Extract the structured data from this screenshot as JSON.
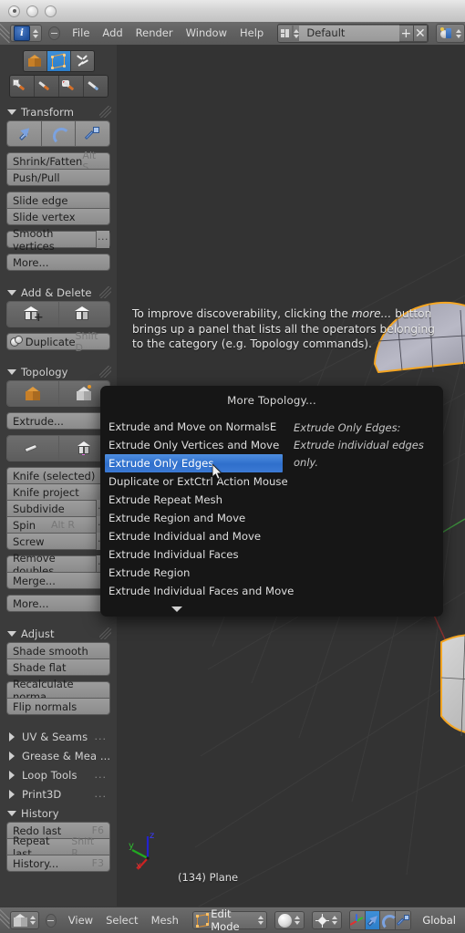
{
  "window": {
    "title_buttons": [
      "close",
      "minimize",
      "zoom"
    ]
  },
  "topbar": {
    "editor_icon": "info-editor-icon",
    "collapse_icon": "collapse-menu-icon",
    "menus": [
      "File",
      "Add",
      "Render",
      "Window",
      "Help"
    ],
    "screen_icon": "screen-layout-icon",
    "screen_value": "Default",
    "add_screen_label": "+",
    "delete_screen_label": "✕",
    "scene_icon": "scene-icon"
  },
  "toolshelf": {
    "mode_tabs": [
      {
        "name": "object-mode-tab",
        "icon": "cube-icon",
        "active": false
      },
      {
        "name": "mesh-edit-tab",
        "icon": "mesh-vertex-icon",
        "active": true
      },
      {
        "name": "rigging-tab",
        "icon": "armature-icon",
        "active": false
      }
    ],
    "paint_tabs": [
      {
        "name": "grease-pencil-tab",
        "icon": "pencil-icon"
      },
      {
        "name": "weight-paint-tab",
        "icon": "bone-brush-icon"
      },
      {
        "name": "texture-paint-tab",
        "icon": "palette-brush-icon"
      },
      {
        "name": "sculpt-tab",
        "icon": "sculpt-brush-icon"
      }
    ],
    "panels": [
      {
        "title": "Transform",
        "open": true,
        "icon_row": [
          {
            "name": "translate-tool",
            "icon": "move-arrow-icon"
          },
          {
            "name": "rotate-tool",
            "icon": "rotate-arc-icon"
          },
          {
            "name": "scale-tool",
            "icon": "scale-icon"
          }
        ],
        "groups": [
          [
            {
              "label": "Shrink/Fatten",
              "shortcut": "Alt S"
            },
            {
              "label": "Push/Pull",
              "shortcut": ""
            }
          ],
          [
            {
              "label": "Slide edge",
              "shortcut": ""
            },
            {
              "label": "Slide vertex",
              "shortcut": ""
            }
          ],
          [
            {
              "label": "Smooth vertices",
              "shortcut": "",
              "ext": true
            }
          ],
          [
            {
              "label": "More...",
              "shortcut": ""
            }
          ]
        ]
      },
      {
        "title": "Add & Delete",
        "open": true,
        "icon_row": [
          {
            "name": "add-cube-tool",
            "icon": "add-cube-icon"
          },
          {
            "name": "delete-cube-tool",
            "icon": "delete-cube-icon"
          }
        ],
        "groups": [
          [
            {
              "label": "Duplicate",
              "shortcut": "Shift D",
              "lead_icon": "duplicate-icon"
            }
          ]
        ]
      },
      {
        "title": "Topology",
        "open": true,
        "icon_row": [
          {
            "name": "extrude-region-tool",
            "icon": "extrude-cube-icon"
          },
          {
            "name": "extrude-vertices-tool",
            "icon": "extrude-vertex-icon"
          }
        ],
        "groups": [
          [
            {
              "label": "Extrude...",
              "shortcut": ""
            }
          ]
        ],
        "icon_row_2": [
          {
            "name": "knife-tool",
            "icon": "knife-icon"
          },
          {
            "name": "bisect-tool",
            "icon": "bisect-cube-icon"
          }
        ],
        "groups_2": [
          [
            {
              "label": "Knife (selected)",
              "shortcut": ""
            },
            {
              "label": "Knife project",
              "shortcut": ""
            },
            {
              "label": "Subdivide",
              "shortcut": "",
              "ext": true
            },
            {
              "label": "Spin",
              "shortcut": "Alt R",
              "ext": true
            },
            {
              "label": "Screw",
              "shortcut": "",
              "ext": true
            }
          ],
          [
            {
              "label": "Remove doubles",
              "shortcut": "",
              "ext": true
            },
            {
              "label": "Merge...",
              "shortcut": ""
            }
          ],
          [
            {
              "label": "More...",
              "shortcut": ""
            }
          ]
        ]
      },
      {
        "title": "Adjust",
        "open": true,
        "groups": [
          [
            {
              "label": "Shade smooth",
              "shortcut": ""
            },
            {
              "label": "Shade flat",
              "shortcut": ""
            }
          ],
          [
            {
              "label": "Recalculate norma",
              "shortcut": ""
            },
            {
              "label": "Flip normals",
              "shortcut": ""
            }
          ]
        ]
      },
      {
        "title": "UV & Seams",
        "open": false,
        "dots": "..."
      },
      {
        "title": "Grease & Mea ...",
        "open": false,
        "dots": ""
      },
      {
        "title": "Loop Tools",
        "open": false,
        "dots": "..."
      },
      {
        "title": "Print3D",
        "open": false,
        "dots": "..."
      },
      {
        "title": "History",
        "open": true,
        "groups": [
          [
            {
              "label": "Redo last",
              "shortcut": "F6"
            },
            {
              "label": "Repeat last",
              "shortcut": "Shift R"
            },
            {
              "label": "History...",
              "shortcut": "F3"
            }
          ]
        ]
      }
    ]
  },
  "viewport": {
    "annotation_line1_pre": "To improve discoverability, clicking the ",
    "annotation_line1_em": "more...",
    "annotation_line1_post": " button",
    "annotation_line2": "brings up a panel that lists  all the operators belonging",
    "annotation_line3": "to the category (e.g. Topology commands).",
    "object_label": "(134) Plane",
    "axis_labels": {
      "x": "x",
      "y": "y",
      "z": "z"
    },
    "axis_colors": {
      "x": "#cc2222",
      "y": "#22aa22",
      "z": "#2222cc"
    },
    "background": "#333333",
    "selection_color": "#f5a623"
  },
  "popup": {
    "title": "More Topology...",
    "items": [
      {
        "label": "Extrude and Move on Normals",
        "shortcut": "E",
        "selected": false
      },
      {
        "label": "Extrude Only Vertices and Move",
        "shortcut": "",
        "selected": false
      },
      {
        "label": "Extrude Only Edges",
        "shortcut": "",
        "selected": true
      },
      {
        "label": "Duplicate or Ext",
        "shortcut": "Ctrl Action Mouse",
        "selected": false
      },
      {
        "label": "Extrude Repeat Mesh",
        "shortcut": "",
        "selected": false
      },
      {
        "label": "Extrude Region and Move",
        "shortcut": "",
        "selected": false
      },
      {
        "label": "Extrude Individual and Move",
        "shortcut": "",
        "selected": false
      },
      {
        "label": "Extrude Individual Faces",
        "shortcut": "",
        "selected": false
      },
      {
        "label": "Extrude Region",
        "shortcut": "",
        "selected": false
      },
      {
        "label": "Extrude Individual Faces and Move",
        "shortcut": "",
        "selected": false
      }
    ],
    "tooltip_heading": "Extrude Only Edges:",
    "tooltip_body": "Extrude individual edges only.",
    "highlight_color": "#3c7ad4",
    "more_indicator": "scroll-down-arrow"
  },
  "statusbar": {
    "object_icon": "object-cube-icon",
    "collapse_icon": "collapse-menu-icon",
    "menus": [
      "View",
      "Select",
      "Mesh"
    ],
    "mode_icon": "mesh-edit-icon",
    "mode_value": "Edit Mode",
    "shading_icon": "solid-shading-icon",
    "pivot_icon": "pivot-point-icon",
    "manipulator_buttons": [
      {
        "name": "manipulator-toggle",
        "icon": "axis-widget-icon",
        "active": false
      },
      {
        "name": "manipulator-translate",
        "icon": "move-arrow-icon",
        "active": true
      },
      {
        "name": "manipulator-rotate",
        "icon": "rotate-arc-icon",
        "active": false
      },
      {
        "name": "manipulator-scale",
        "icon": "scale-icon",
        "active": false
      }
    ],
    "orientation_value": "Global"
  }
}
